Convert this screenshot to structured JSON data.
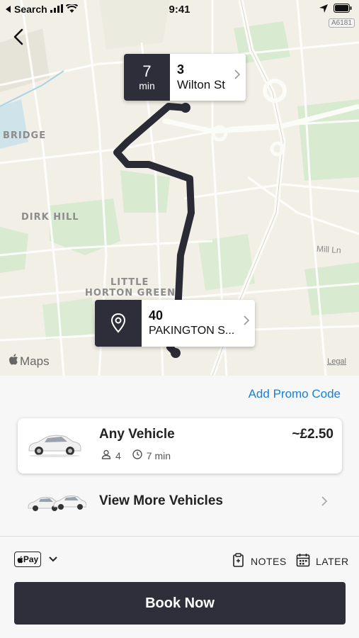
{
  "status_bar": {
    "back_app": "Search",
    "time": "9:41"
  },
  "map": {
    "area_labels": [
      "BRIDGE",
      "DIRK HILL",
      "LITTLE",
      "HORTON GREEN"
    ],
    "road_badge": "A6181",
    "street_label": "Mill Ln",
    "maps_brand": "Maps",
    "legal": "Legal",
    "pickup": {
      "eta_value": "7",
      "eta_unit": "min",
      "number": "3",
      "street": "Wilton St"
    },
    "dropoff": {
      "number": "40",
      "street": "PAKINGTON S..."
    }
  },
  "panel": {
    "promo_label": "Add Promo Code",
    "vehicle": {
      "name": "Any Vehicle",
      "price": "~£2.50",
      "seats": "4",
      "eta": "7 min"
    },
    "more_label": "View More Vehicles",
    "payment": {
      "method_label": "Pay"
    },
    "notes_label": "NOTES",
    "later_label": "LATER",
    "book_label": "Book Now"
  },
  "colors": {
    "primary_dark": "#2e2f3a",
    "link_blue": "#1a7fd6",
    "map_bg": "#f2f0e6",
    "park_green": "#d8ead0",
    "route": "#2b2b36"
  }
}
